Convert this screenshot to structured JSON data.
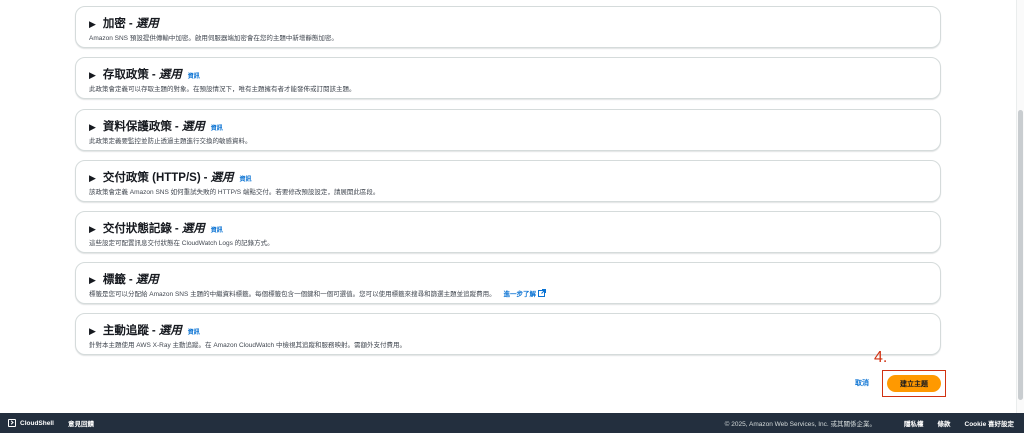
{
  "sections": [
    {
      "title": "加密",
      "optional": "選用",
      "info": "",
      "desc": "Amazon SNS 預設提供傳輸中加密。啟用伺服器端加密會在您的主題中新增靜態加密。"
    },
    {
      "title": "存取政策",
      "optional": "選用",
      "info": "資訊",
      "desc": "此政策會定義可以存取主題的對象。在預設情況下，唯有主題擁有者才能發佈或訂閱該主題。"
    },
    {
      "title": "資料保護政策",
      "optional": "選用",
      "info": "資訊",
      "desc": "此政策定義要監控並防止透過主題進行交換的敏感資料。"
    },
    {
      "title": "交付政策 (HTTP/S)",
      "optional": "選用",
      "info": "資訊",
      "desc": "該政策會定義 Amazon SNS 如何重試失敗的 HTTP/S 端點交付。若要修改預設設定，請展開此區段。"
    },
    {
      "title": "交付狀態記錄",
      "optional": "選用",
      "info": "資訊",
      "desc": "這些設定可配置訊息交付狀態在 CloudWatch Logs 的記錄方式。"
    },
    {
      "title": "標籤",
      "optional": "選用",
      "info": "",
      "desc": "標籤是您可以分配給 Amazon SNS 主題的中繼資料標籤。每個標籤包含一個鍵和一個可選值。您可以使用標籤來搜尋和篩選主題並追蹤費用。",
      "learn_more": "進一步了解"
    },
    {
      "title": "主動追蹤",
      "optional": "選用",
      "info": "資訊",
      "desc": "針對本主題使用 AWS X-Ray 主動追蹤。在 Amazon CloudWatch 中檢視其追蹤和服務映射。需額外支付費用。"
    }
  ],
  "separator": "-",
  "annotation": "4.",
  "actions": {
    "cancel": "取消",
    "create": "建立主題"
  },
  "footer": {
    "cloudshell": "CloudShell",
    "feedback": "意見回饋",
    "copyright": "© 2025, Amazon Web Services, Inc. 或其關係企業。",
    "privacy": "隱私權",
    "terms": "條款",
    "cookie": "Cookie 喜好設定"
  },
  "colors": {
    "accent": "#0972d3",
    "primary_button": "#ff9900",
    "annotation": "#d13212",
    "footer_bg": "#232f3e"
  }
}
